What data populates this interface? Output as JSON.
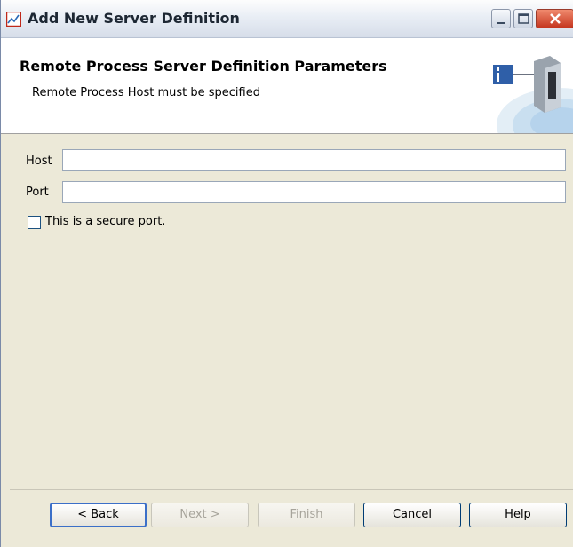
{
  "window": {
    "title": "Add New Server Definition"
  },
  "header": {
    "title": "Remote Process Server Definition Parameters",
    "subtitle": "Remote Process Host must be specified"
  },
  "form": {
    "host_label": "Host",
    "host_value": "",
    "port_label": "Port",
    "port_value": "",
    "secure_label": "This is a secure port.",
    "secure_checked": false
  },
  "buttons": {
    "back": "< Back",
    "next": "Next >",
    "finish": "Finish",
    "cancel": "Cancel",
    "help": "Help"
  },
  "colors": {
    "accent": "#3b6fc8",
    "close_red": "#c5361f"
  }
}
